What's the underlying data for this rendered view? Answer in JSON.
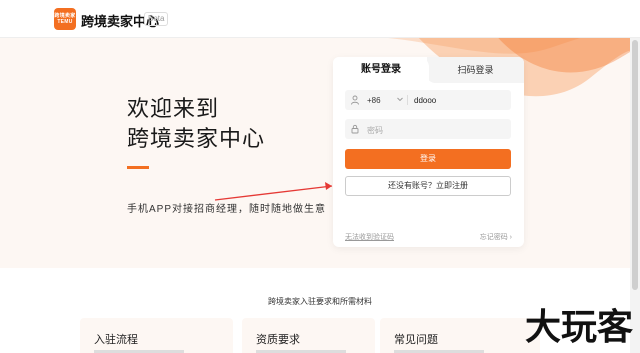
{
  "header": {
    "logo_lines": [
      "跨境卖家",
      "TEMU"
    ],
    "title": "跨境卖家中心",
    "badge": "Beta"
  },
  "hero": {
    "welcome_line1": "欢迎来到",
    "welcome_line2": "跨境卖家中心",
    "subtitle": "手机APP对接招商经理，随时随地做生意"
  },
  "login": {
    "tab_account": "账号登录",
    "tab_scan": "扫码登录",
    "country_code": "+86",
    "phone_value": "ddooo",
    "password_placeholder": "密码",
    "login_label": "登录",
    "register_label": "还没有账号？立即注册",
    "no_code_link": "无法收到验证码",
    "forgot_link": "忘记密码 ›"
  },
  "section": {
    "title": "跨境卖家入驻要求和所需材料",
    "cards": [
      "入驻流程",
      "资质要求",
      "常见问题"
    ]
  },
  "watermark": "大玩客",
  "colors": {
    "accent": "#f36f21",
    "hero_bg": "#fdf7f3"
  }
}
